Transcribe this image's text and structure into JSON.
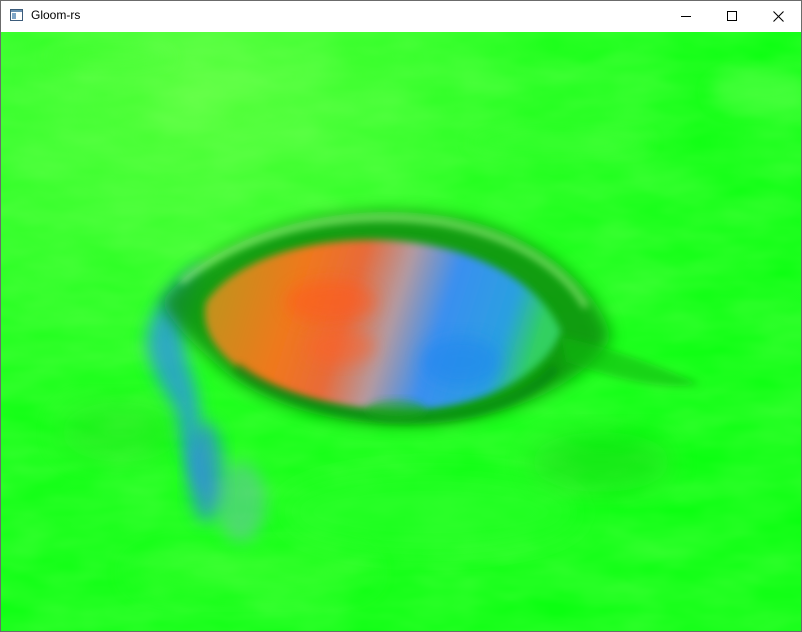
{
  "window": {
    "title": "Gloom-rs",
    "icon": "app-window-icon",
    "controls": {
      "minimize_icon": "minimize-icon",
      "maximize_icon": "maximize-icon",
      "close_icon": "close-icon"
    }
  },
  "scene": {
    "description_icon": "terrain-heightmap",
    "colors": {
      "ground": "#0bff11",
      "high": "#ff5a1e",
      "mid": "#c8a060",
      "low": "#2a8ff0",
      "shadow": "#058a0a"
    }
  }
}
